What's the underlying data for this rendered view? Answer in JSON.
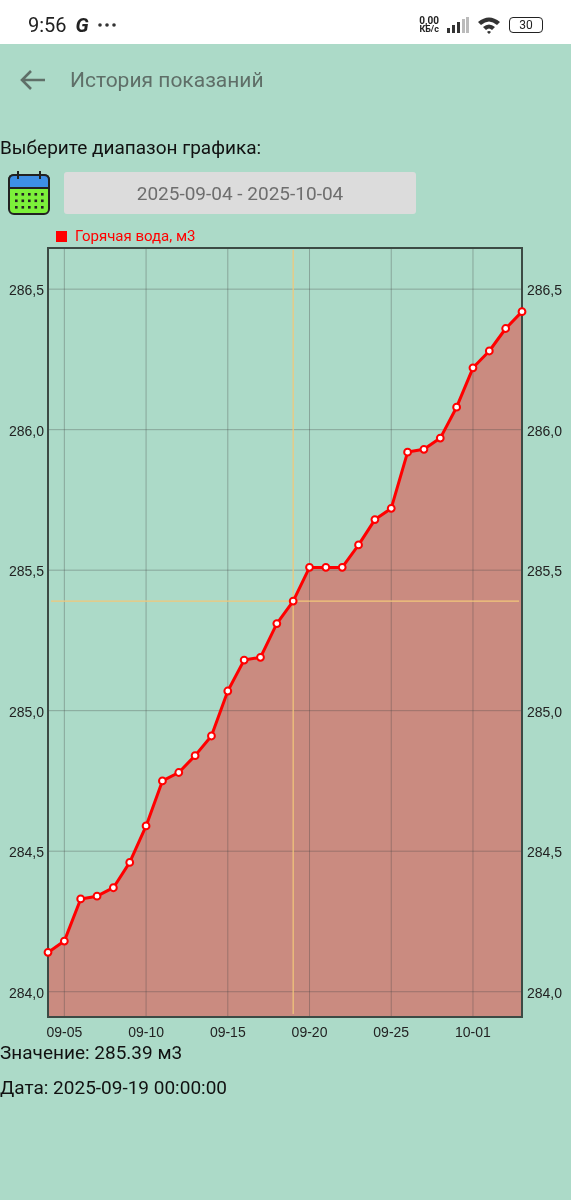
{
  "status_bar": {
    "time": "9:56",
    "app_glyph": "G",
    "speed_value": "0,00",
    "speed_unit": "КБ/с",
    "battery": "30"
  },
  "app_bar": {
    "title": "История показаний"
  },
  "range": {
    "label": "Выберите диапазон графика:",
    "value": "2025-09-04  -  2025-10-04"
  },
  "chart": {
    "chart_data": {
      "type": "area",
      "categories": [
        null,
        "09-05",
        null,
        null,
        null,
        null,
        "09-10",
        null,
        null,
        null,
        null,
        "09-15",
        null,
        null,
        null,
        null,
        "09-20",
        null,
        null,
        null,
        null,
        "09-25",
        null,
        null,
        null,
        null,
        "10-01",
        null,
        null,
        null
      ],
      "series": [
        {
          "name": "Горячая вода, м3",
          "color": "#ff0000",
          "values": [
            284.14,
            284.18,
            284.33,
            284.34,
            284.37,
            284.46,
            284.59,
            284.75,
            284.78,
            284.84,
            284.91,
            285.07,
            285.18,
            285.19,
            285.31,
            285.39,
            285.51,
            285.51,
            285.51,
            285.59,
            285.68,
            285.72,
            285.92,
            285.93,
            285.97,
            286.08,
            286.22,
            286.28,
            286.36,
            286.42
          ]
        }
      ],
      "ylim": [
        283.91,
        286.65
      ],
      "yticks": [
        {
          "value": 284.0,
          "label": "284,0"
        },
        {
          "value": 284.5,
          "label": "284,5"
        },
        {
          "value": 285.0,
          "label": "285,0"
        },
        {
          "value": 285.5,
          "label": "285,5"
        },
        {
          "value": 286.0,
          "label": "286,0"
        },
        {
          "value": 286.5,
          "label": "286,5"
        }
      ],
      "grid": true,
      "ref_lines": [
        {
          "axis": "y",
          "value": 285.39,
          "color": "#f2c77a"
        }
      ]
    }
  },
  "selection": [
    {
      "text": "Значение: 285.39 м3"
    },
    {
      "text": "Дата: 2025-09-19 00:00:00"
    }
  ]
}
